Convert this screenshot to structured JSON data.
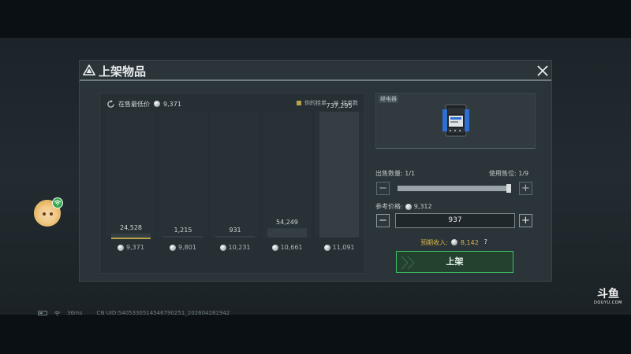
{
  "dialog": {
    "title": "上架物品",
    "chart_panel": {
      "lowest_price_label": "在售最低价",
      "lowest_price_value": "9,371",
      "legend": [
        {
          "label": "你的挂单",
          "color": "#b9a24a"
        },
        {
          "label": "挂单数",
          "color": "#5b6569"
        }
      ],
      "bars": [
        {
          "count": "24,528",
          "price": "9,371",
          "fill_ratio": 0.0333,
          "yours": true
        },
        {
          "count": "1,215",
          "price": "9,801",
          "fill_ratio": 0.0017,
          "yours": false
        },
        {
          "count": "931",
          "price": "10,231",
          "fill_ratio": 0.0013,
          "yours": false
        },
        {
          "count": "54,249",
          "price": "10,661",
          "fill_ratio": 0.0736,
          "yours": false
        },
        {
          "count": "737,295",
          "price": "11,091",
          "fill_ratio": 1.0,
          "yours": false
        }
      ]
    },
    "item": {
      "name": "继电器",
      "icon": "relay-item-icon"
    },
    "sell_quantity": {
      "label": "出售数量: 1/1",
      "slots_label": "使用售位: 1/9",
      "level": 1.0,
      "minus": "−",
      "plus": "+"
    },
    "reference_price": {
      "label": "参考价格:",
      "value": "9,312"
    },
    "price_input": {
      "value": "937",
      "minus": "−",
      "plus": "+"
    },
    "expected_income": {
      "label": "预期收入:",
      "value": "8,142",
      "help": "?"
    },
    "submit_label": "上架"
  },
  "status_bar": {
    "latency": "36ms",
    "uid": "CN UID:5405330514546790251_202604281942"
  },
  "watermark": {
    "main": "斗鱼",
    "sub": "DOUYU.COM"
  },
  "colors": {
    "accent_green": "#3fbf66",
    "income_gold": "#d9b64a",
    "your_listing": "#b9a24a",
    "listing_count": "#5b6569"
  }
}
